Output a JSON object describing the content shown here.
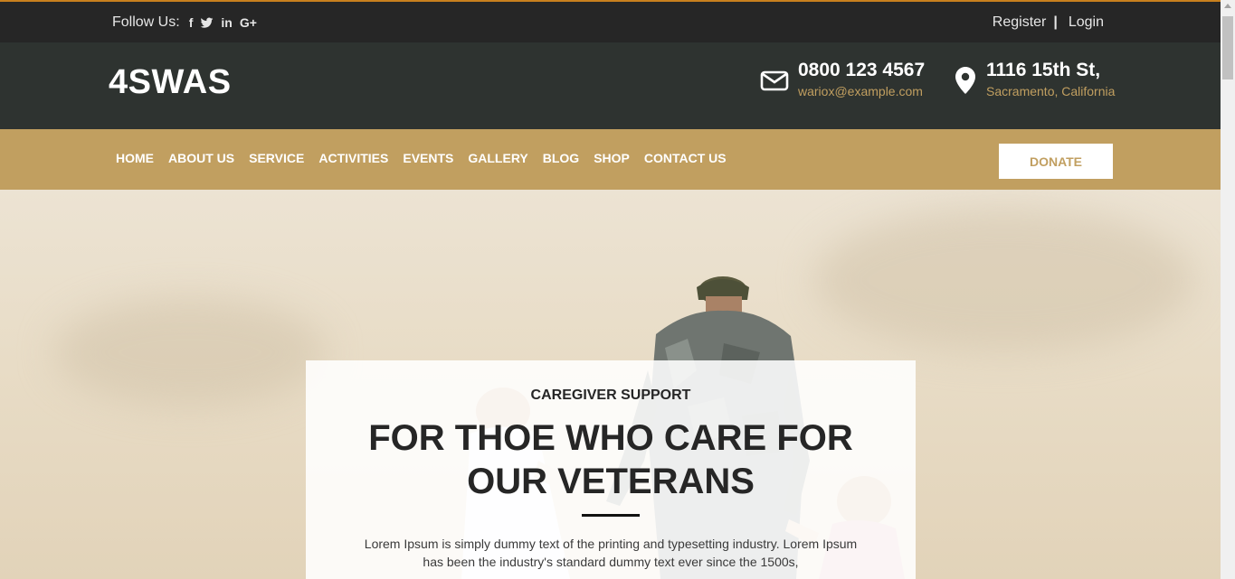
{
  "topbar": {
    "follow_label": "Follow Us:",
    "social": [
      {
        "icon": "facebook-icon",
        "glyph": "f"
      },
      {
        "icon": "twitter-icon",
        "glyph": ""
      },
      {
        "icon": "linkedin-icon",
        "glyph": "in"
      },
      {
        "icon": "google-plus-icon",
        "glyph": "G+"
      }
    ],
    "register": "Register",
    "separator": "|",
    "login": "Login"
  },
  "header": {
    "logo": "4SWAS",
    "phone": "0800 123 4567",
    "email": "wariox@example.com",
    "address": "1116 15th St,",
    "city": "Sacramento, California"
  },
  "nav": {
    "items": [
      "HOME",
      "ABOUT US",
      "SERVICE",
      "ACTIVITIES",
      "EVENTS",
      "GALLERY",
      "BLOG",
      "SHOP",
      "CONTACT US"
    ],
    "donate": "DONATE"
  },
  "hero": {
    "kicker": "CAREGIVER SUPPORT",
    "title": "FOR THOE WHO CARE FOR OUR VETERANS",
    "body": "Lorem Ipsum is simply dummy text of the printing and typesetting industry. Lorem Ipsum has been the industry's standard dummy text ever since the 1500s,"
  },
  "colors": {
    "accent": "#c19f60",
    "topbar": "#262626",
    "header": "#2e3330",
    "top_border": "#c8801e"
  }
}
